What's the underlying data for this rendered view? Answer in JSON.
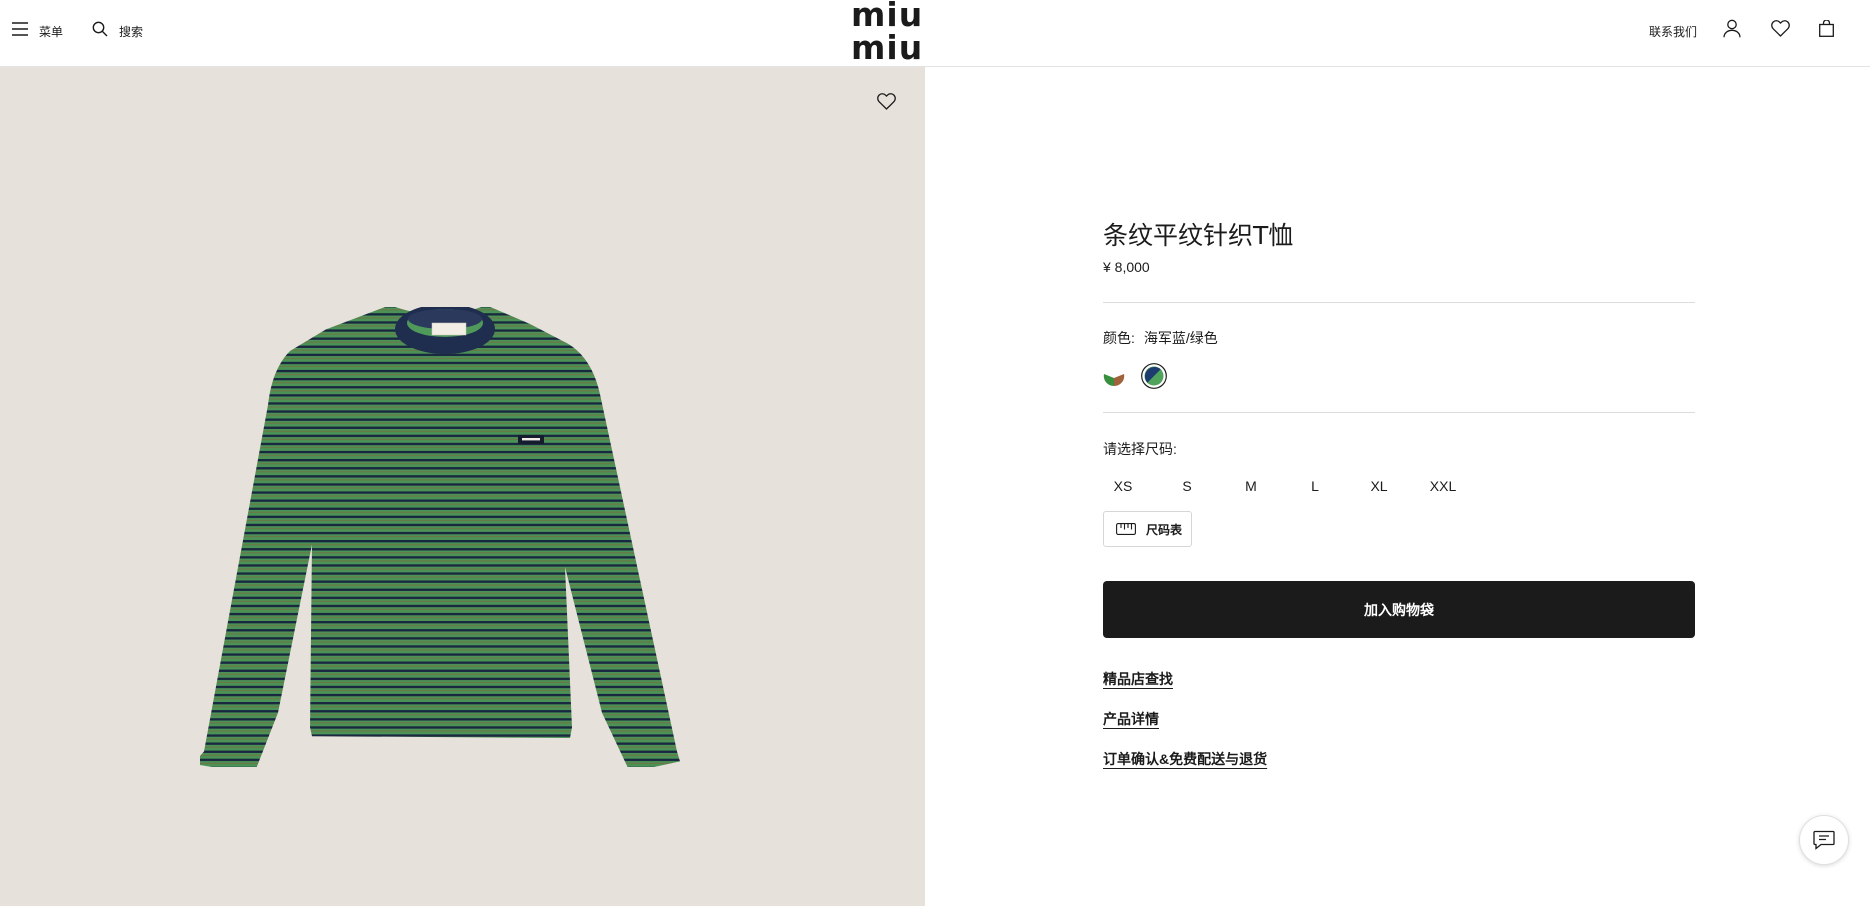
{
  "header": {
    "menu_label": "菜单",
    "search_label": "搜索",
    "logo_text": "miu miu",
    "contact_label": "联系我们",
    "icons": [
      "menu-icon",
      "search-icon",
      "user-icon",
      "heart-icon",
      "bag-icon"
    ]
  },
  "product": {
    "title": "条纹平纹针织T恤",
    "price": "¥ 8,000",
    "color_label": "颜色:",
    "color_value": "海军蓝/绿色",
    "swatches": [
      {
        "name": "green-brown",
        "colors": [
          "#3a8f3e",
          "#a0623a"
        ],
        "selected": false
      },
      {
        "name": "navy-green",
        "colors": [
          "#1d3b6e",
          "#4fa35a"
        ],
        "selected": true
      }
    ],
    "size_label": "请选择尺码:",
    "sizes": [
      "XS",
      "S",
      "M",
      "L",
      "XL",
      "XXL"
    ],
    "size_chart_label": "尺码表",
    "add_to_bag_label": "加入购物袋",
    "links": [
      "精品店查找",
      "产品详情",
      "订单确认&免费配送与退货"
    ]
  },
  "colors": {
    "image_bg": "#e6e1da",
    "button_bg": "#1b1b1b",
    "stripe_green": "#4f9a5b",
    "stripe_navy": "#1c2a44",
    "collar": "#1f2d4f"
  }
}
